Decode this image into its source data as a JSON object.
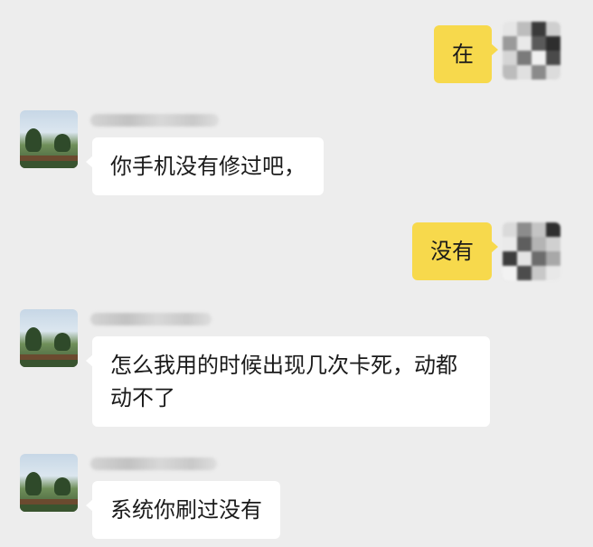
{
  "messages": [
    {
      "sender": "self",
      "text": "在"
    },
    {
      "sender": "other",
      "sender_name": "",
      "text": "你手机没有修过吧，"
    },
    {
      "sender": "self",
      "text": "没有"
    },
    {
      "sender": "other",
      "sender_name": "",
      "text": "怎么我用的时候出现几次卡死，动都动不了"
    },
    {
      "sender": "other",
      "sender_name": "",
      "text": "系统你刷过没有"
    }
  ],
  "colors": {
    "background": "#ededed",
    "self_bubble": "#f7d94c",
    "other_bubble": "#ffffff"
  },
  "icons": {
    "self_avatar": "pixelated-avatar",
    "other_avatar": "landscape-photo-avatar"
  }
}
